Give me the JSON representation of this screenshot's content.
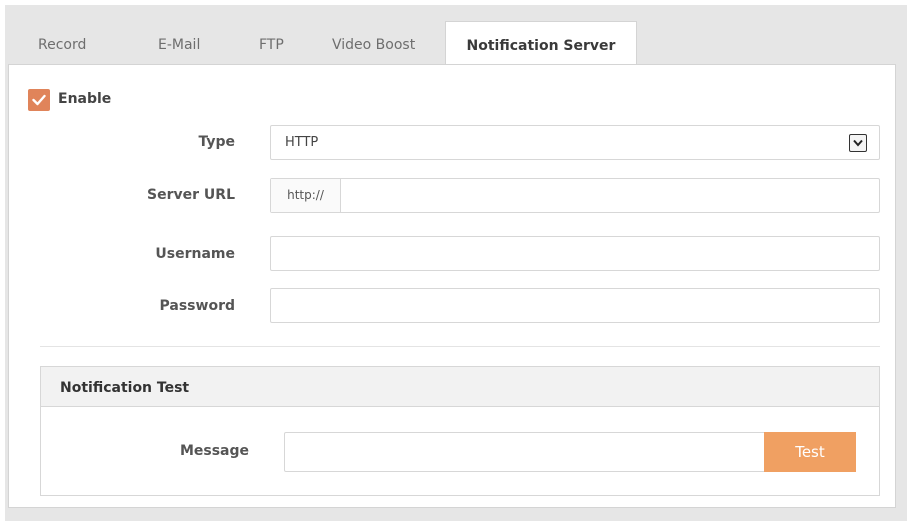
{
  "tabs": [
    {
      "label": "Record",
      "active": false
    },
    {
      "label": "E-Mail",
      "active": false
    },
    {
      "label": "FTP",
      "active": false
    },
    {
      "label": "Video Boost",
      "active": false
    },
    {
      "label": "Notification Server",
      "active": true
    }
  ],
  "enable": {
    "label": "Enable",
    "checked": true
  },
  "type": {
    "label": "Type",
    "value": "HTTP"
  },
  "server_url": {
    "label": "Server URL",
    "prefix": "http://",
    "value": ""
  },
  "username": {
    "label": "Username",
    "value": ""
  },
  "password": {
    "label": "Password",
    "value": ""
  },
  "notification_test": {
    "title": "Notification Test",
    "message_label": "Message",
    "message_value": "",
    "test_button": "Test"
  },
  "colors": {
    "accent": "#e0845a",
    "button": "#f0a062",
    "border": "#d7d7d7",
    "background": "#e6e6e6"
  },
  "icons": {
    "checkbox": "check-icon",
    "select": "chevron-down-icon"
  }
}
